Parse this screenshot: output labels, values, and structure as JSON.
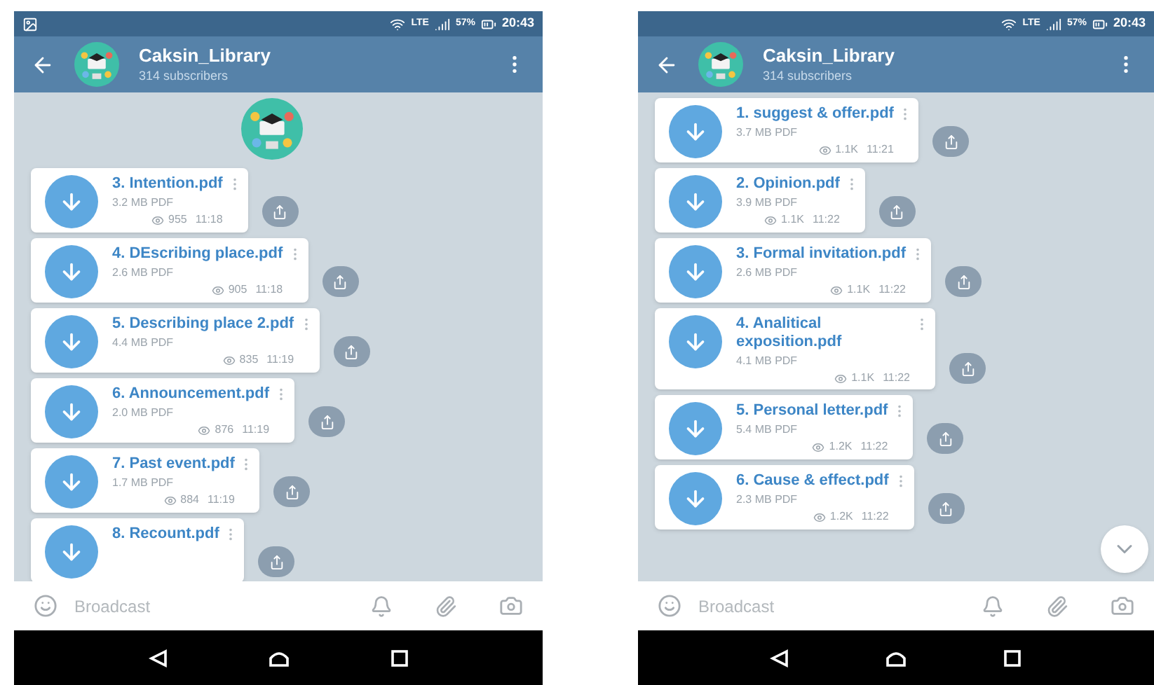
{
  "phones": [
    {
      "status_bar": {
        "notification_icon": true,
        "network": "LTE",
        "battery": "57%",
        "time": "20:43"
      },
      "header": {
        "title": "Caksin_Library",
        "subtitle": "314 subscribers"
      },
      "channel_photo": true,
      "messages": [
        {
          "title": "3. Intention.pdf",
          "size": "3.2 MB PDF",
          "views": "955",
          "time": "11:18"
        },
        {
          "title": "4.  DEscribing place.pdf",
          "size": "2.6 MB PDF",
          "views": "905",
          "time": "11:18"
        },
        {
          "title": "5. Describing place 2.pdf",
          "size": "4.4 MB PDF",
          "views": "835",
          "time": "11:19"
        },
        {
          "title": "6. Announcement.pdf",
          "size": "2.0 MB PDF",
          "views": "876",
          "time": "11:19"
        },
        {
          "title": "7. Past event.pdf",
          "size": "1.7 MB PDF",
          "views": "884",
          "time": "11:19"
        },
        {
          "title": "8. Recount.pdf"
        }
      ],
      "input": {
        "placeholder": "Broadcast"
      },
      "scroll_down_button": false
    },
    {
      "status_bar": {
        "notification_icon": false,
        "network": "LTE",
        "battery": "57%",
        "time": "20:43"
      },
      "header": {
        "title": "Caksin_Library",
        "subtitle": "314 subscribers"
      },
      "channel_photo": false,
      "messages": [
        {
          "title": "1. suggest & offer.pdf",
          "size": "3.7 MB PDF",
          "views": "1.1K",
          "time": "11:21"
        },
        {
          "title": "2. Opinion.pdf",
          "size": "3.9 MB PDF",
          "views": "1.1K",
          "time": "11:22"
        },
        {
          "title": "3. Formal invitation.pdf",
          "size": "2.6 MB PDF",
          "views": "1.1K",
          "time": "11:22"
        },
        {
          "title": "4. Analitical exposition.pdf",
          "size": "4.1 MB PDF",
          "views": "1.1K",
          "time": "11:22"
        },
        {
          "title": "5. Personal letter.pdf",
          "size": "5.4 MB PDF",
          "views": "1.2K",
          "time": "11:22"
        },
        {
          "title": "6. Cause  &  effect.pdf",
          "size": "2.3 MB PDF",
          "views": "1.2K",
          "time": "11:22"
        }
      ],
      "input": {
        "placeholder": "Broadcast"
      },
      "scroll_down_button": true
    }
  ]
}
